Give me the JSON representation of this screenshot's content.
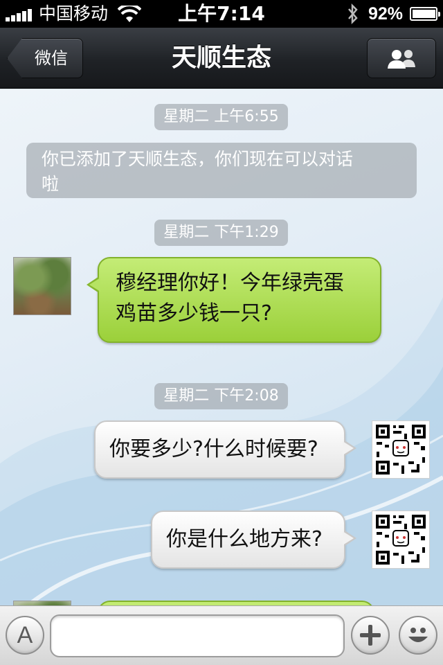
{
  "status_bar": {
    "carrier": "中国移动",
    "time": "上午7:14",
    "battery_percent": "92%",
    "battery_level": 0.92,
    "icons": [
      "signal-icon",
      "wifi-icon",
      "bluetooth-icon",
      "battery-icon"
    ]
  },
  "nav": {
    "back_label": "微信",
    "title": "天顺生态",
    "right_icon": "contacts-icon"
  },
  "messages": {
    "timestamp_1": "星期二 上午6:55",
    "system_line_1": "你已添加了天顺生态，你们现在可以对话",
    "system_line_2": "啦",
    "timestamp_2": "星期二 下午1:29",
    "incoming_1_line_1": "穆经理你好！今年绿壳蛋",
    "incoming_1_line_2": "鸡苗多少钱一只?",
    "timestamp_3": "星期二 下午2:08",
    "outgoing_1": "你要多少?什么时候要?",
    "outgoing_2": "你是什么地方来?"
  },
  "toolbar": {
    "keyboard_label": "A",
    "input_value": "",
    "icons": [
      "keyboard-icon",
      "plus-icon",
      "emoji-icon"
    ]
  },
  "colors": {
    "incoming_bubble": "#a8dc48",
    "outgoing_bubble": "#f0f0f0",
    "nav_bar": "#25282c"
  }
}
